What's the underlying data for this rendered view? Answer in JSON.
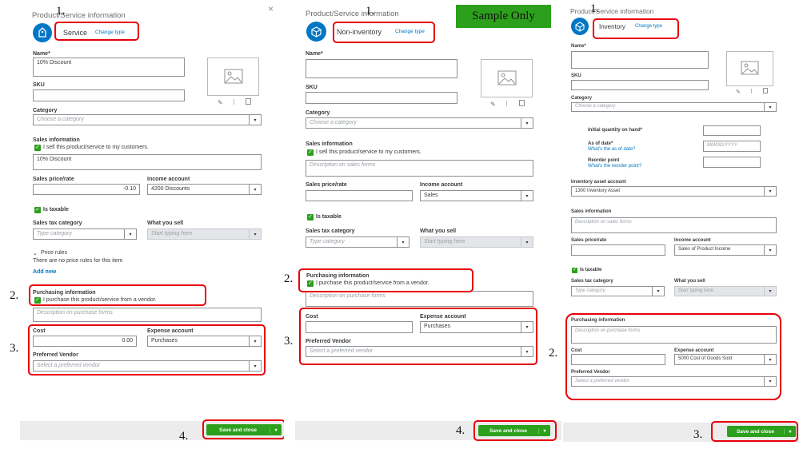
{
  "sample_badge": "Sample Only",
  "panels": [
    {
      "marker_type": "1.",
      "header": "Product/Service information",
      "type_name": "Service",
      "change_type": "Change type",
      "close": "×",
      "name_label": "Name*",
      "name_value": "10% Discount",
      "sku_label": "SKU",
      "category_label": "Category",
      "category_placeholder": "Choose a category",
      "sales_info_label": "Sales information",
      "sales_check_label": "I sell this product/service to my customers.",
      "sales_desc_value": "10% Discount",
      "sales_price_label": "Sales price/rate",
      "sales_price_value": "-0.10",
      "income_account_label": "Income account",
      "income_account_value": "4200 Discounts",
      "is_taxable_label": "Is taxable",
      "sales_tax_label": "Sales tax category",
      "sales_tax_placeholder": "Type category",
      "what_you_sell_label": "What you sell",
      "what_you_sell_placeholder": "Start typing here",
      "price_rules_label": "Price rules",
      "price_rules_text": "There are no price rules for this item",
      "add_new": "Add new",
      "marker_purchasing": "2.",
      "purchasing_label": "Purchasing information",
      "purchasing_check_label": "I purchase this product/service from a vendor.",
      "purchasing_desc_placeholder": "Description on purchase forms",
      "marker_cost": "3.",
      "cost_label": "Cost",
      "cost_value": "0.00",
      "expense_label": "Expense account",
      "expense_value": "Purchases",
      "vendor_label": "Preferred Vendor",
      "vendor_placeholder": "Select a preferred vendor",
      "marker_save": "4.",
      "save_label": "Save and close"
    },
    {
      "marker_type": "1.",
      "header": "Product/Service information",
      "type_name": "Non-inventory",
      "change_type": "Change type",
      "name_label": "Name*",
      "sku_label": "SKU",
      "category_label": "Category",
      "category_placeholder": "Choose a category",
      "sales_info_label": "Sales information",
      "sales_check_label": "I sell this product/service to my customers.",
      "sales_desc_placeholder": "Description on sales forms",
      "sales_price_label": "Sales price/rate",
      "income_account_label": "Income account",
      "income_account_value": "Sales",
      "is_taxable_label": "Is taxable",
      "sales_tax_label": "Sales tax category",
      "sales_tax_placeholder": "Type category",
      "what_you_sell_label": "What you sell",
      "what_you_sell_placeholder": "Start typing here",
      "marker_purchasing": "2.",
      "purchasing_label": "Purchasing information",
      "purchasing_check_label": "I purchase this product/service from a vendor.",
      "purchasing_desc_placeholder": "Description on purchase forms",
      "marker_cost": "3.",
      "cost_label": "Cost",
      "expense_label": "Expense account",
      "expense_value": "Purchases",
      "vendor_label": "Preferred Vendor",
      "vendor_placeholder": "Select a preferred vendor",
      "marker_save": "4.",
      "save_label": "Save and close"
    },
    {
      "marker_type": "1.",
      "header": "Product/Service information",
      "type_name": "Inventory",
      "change_type": "Change type",
      "name_label": "Name*",
      "sku_label": "SKU",
      "category_label": "Category",
      "category_placeholder": "Choose a category",
      "initial_qty_label": "Initial quantity on hand*",
      "as_of_date_label": "As of date*",
      "as_of_date_link": "What's the as of date?",
      "as_of_date_placeholder": "MM/DD/YYYY",
      "reorder_label": "Reorder point",
      "reorder_link": "What's the reorder point?",
      "asset_account_label": "Inventory asset account",
      "asset_account_value": "1300 Inventory Asset",
      "sales_info_label": "Sales information",
      "sales_desc_placeholder": "Description on sales forms",
      "sales_price_label": "Sales price/rate",
      "income_account_label": "Income account",
      "income_account_value": "Sales of Product Income",
      "is_taxable_label": "Is taxable",
      "sales_tax_label": "Sales tax category",
      "sales_tax_placeholder": "Type category",
      "what_you_sell_label": "What you sell",
      "what_you_sell_placeholder": "Start typing here",
      "marker_purchasing": "2.",
      "purchasing_label": "Purchasing information",
      "purchasing_desc_placeholder": "Description on purchase forms",
      "cost_label": "Cost",
      "expense_label": "Expense account",
      "expense_value": "5000 Cost of Goods Sold",
      "vendor_label": "Preferred Vendor",
      "vendor_placeholder": "Select a preferred vendor",
      "marker_save": "3.",
      "save_label": "Save and close"
    }
  ],
  "colors": {
    "accent_green": "#2ca01c",
    "link_blue": "#0077c5",
    "annotation_red": "#e8000b"
  },
  "icons": [
    "tag-icon",
    "box-icon",
    "image-placeholder-icon",
    "pencil-icon",
    "trash-icon",
    "checkmark-icon",
    "chevron-down-icon",
    "close-icon"
  ]
}
